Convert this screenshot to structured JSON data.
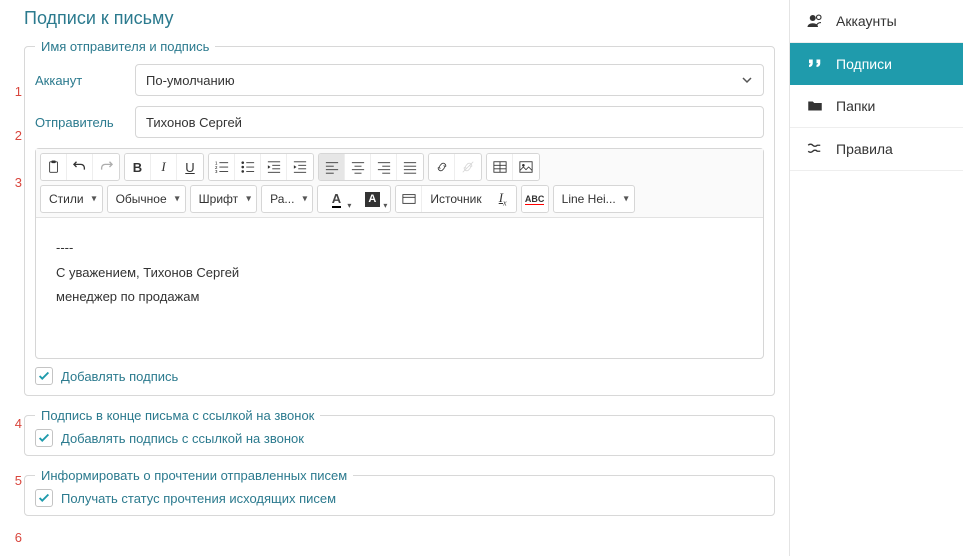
{
  "page_title": "Подписи к письму",
  "markers": {
    "n1": "1",
    "n2": "2",
    "n3": "3",
    "n4": "4",
    "n5": "5",
    "n6": "6"
  },
  "group1": {
    "legend": "Имя отправителя и подпись",
    "account_label": "Акканут",
    "account_value": "По-умолчанию",
    "sender_label": "Отправитель",
    "sender_value": "Тихонов Сергей",
    "toolbar": {
      "styles": "Стили",
      "format": "Обычное",
      "font": "Шрифт",
      "size": "Ра...",
      "source": "Источник",
      "lineheight": "Line Hei..."
    },
    "signature_body": {
      "l1": "----",
      "l2": "С уважением, Тихонов Сергей",
      "l3": "менеджер по продажам"
    },
    "add_sig_label": "Добавлять подпись",
    "add_sig_checked": true
  },
  "group2": {
    "legend": "Подпись в конце письма с ссылкой на звонок",
    "cb_label": "Добавлять подпись с ссылкой на звонок",
    "checked": true
  },
  "group3": {
    "legend": "Информировать о прочтении отправленных писем",
    "cb_label": "Получать статус прочтения исходящих писем",
    "checked": true
  },
  "sidebar": {
    "items": [
      {
        "label": "Аккаунты",
        "active": false
      },
      {
        "label": "Подписи",
        "active": true
      },
      {
        "label": "Папки",
        "active": false
      },
      {
        "label": "Правила",
        "active": false
      }
    ]
  }
}
